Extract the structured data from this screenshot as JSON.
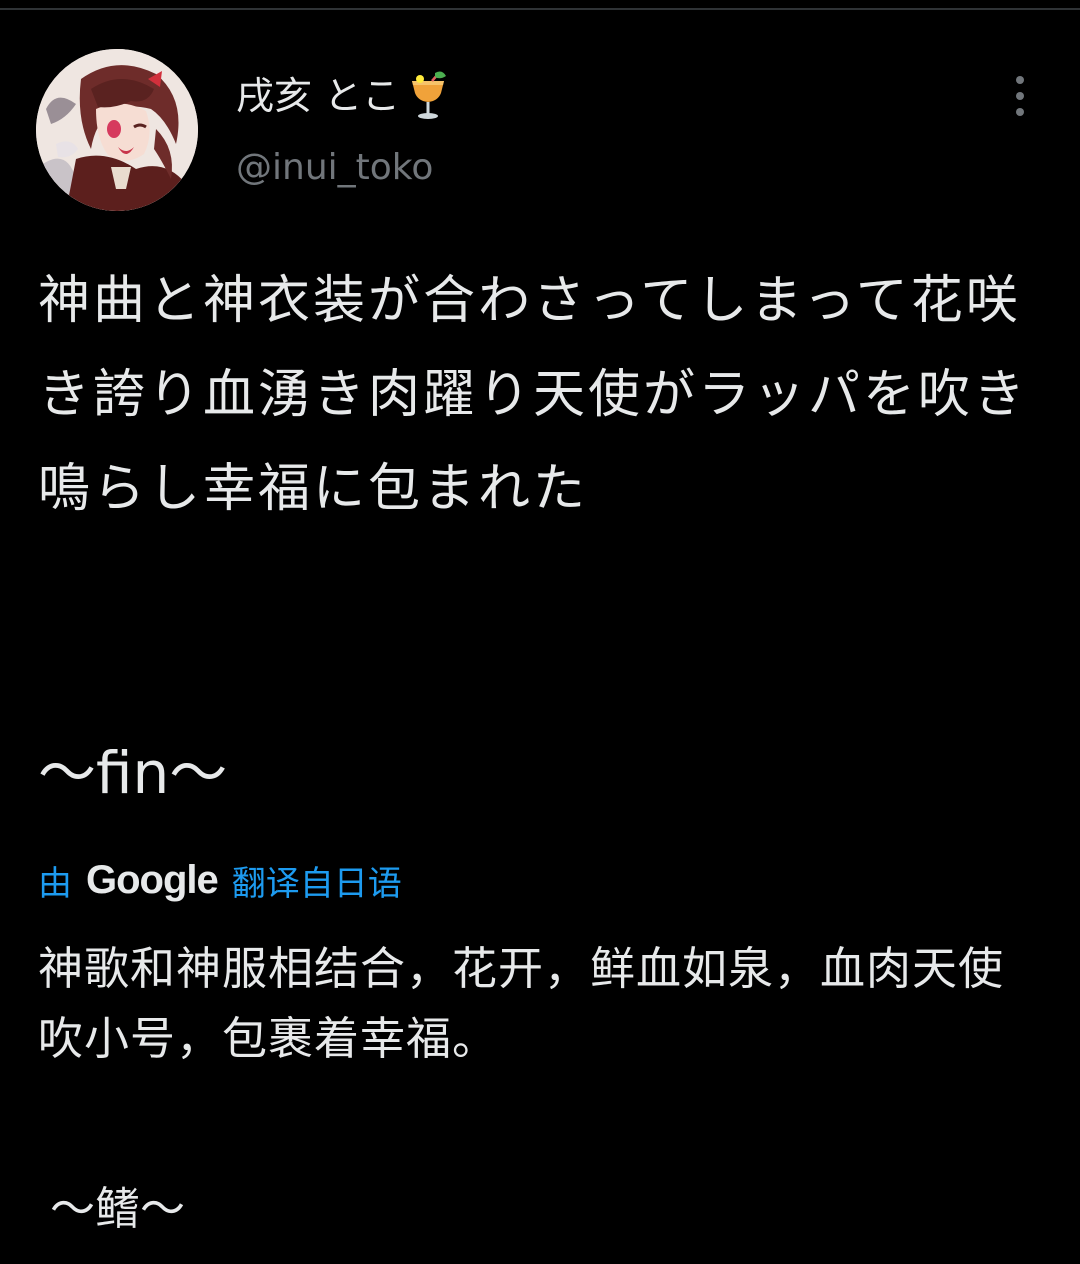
{
  "tweet": {
    "author": {
      "display_name": "戌亥 とこ",
      "name_emoji": "tropical-drink-emoji",
      "handle": "@inui_toko",
      "avatar": "avatar-anime-character"
    },
    "menu_icon": "more-vertical-icon",
    "text": "神曲と神衣装が合わさってしまって花咲き誇り血湧き肉躍り天使がラッパを吹き鳴らし幸福に包まれた",
    "fin": "～fin～"
  },
  "translation": {
    "prefix": "由",
    "provider": "Google",
    "suffix": "翻译自日语",
    "text": "神歌和神服相结合，花开，鲜血如泉，血肉天使吹小号，包裹着幸福。",
    "fin": "～鳍～"
  },
  "colors": {
    "background": "#000000",
    "text_primary": "#e7e9ea",
    "text_secondary": "#71767b",
    "link": "#1d9bf0"
  }
}
